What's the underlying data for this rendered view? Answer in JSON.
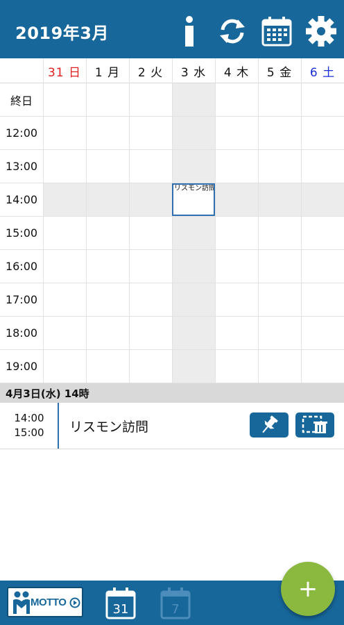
{
  "header": {
    "title": "2019年3月",
    "bg_color": "#17679a",
    "buttons": [
      "info-icon",
      "sync-icon",
      "calendar-icon",
      "gear-icon"
    ]
  },
  "week": {
    "days": [
      {
        "label": "31 日",
        "color": "#e02020"
      },
      {
        "label": "1 月",
        "color": "#111111"
      },
      {
        "label": "2 火",
        "color": "#111111"
      },
      {
        "label": "3 水",
        "color": "#111111"
      },
      {
        "label": "4 木",
        "color": "#111111"
      },
      {
        "label": "5 金",
        "color": "#111111"
      },
      {
        "label": "6 土",
        "color": "#1a2fd8"
      }
    ],
    "rows": [
      "終日",
      "12:00",
      "13:00",
      "14:00",
      "15:00",
      "16:00",
      "17:00",
      "18:00",
      "19:00"
    ],
    "event_chip": "リスモン訪問"
  },
  "selected": {
    "date_label": "4月3日(水) 14時",
    "event": {
      "start": "14:00",
      "end": "15:00",
      "title": "リスモン訪問"
    },
    "actions": [
      "pin-icon",
      "copy-delete-icon"
    ]
  },
  "bottom": {
    "logo_text": "MOTTO",
    "month_cal_number": "31",
    "week_cal_number": "7",
    "fab_label": "+",
    "fab_color": "#8bb940"
  }
}
